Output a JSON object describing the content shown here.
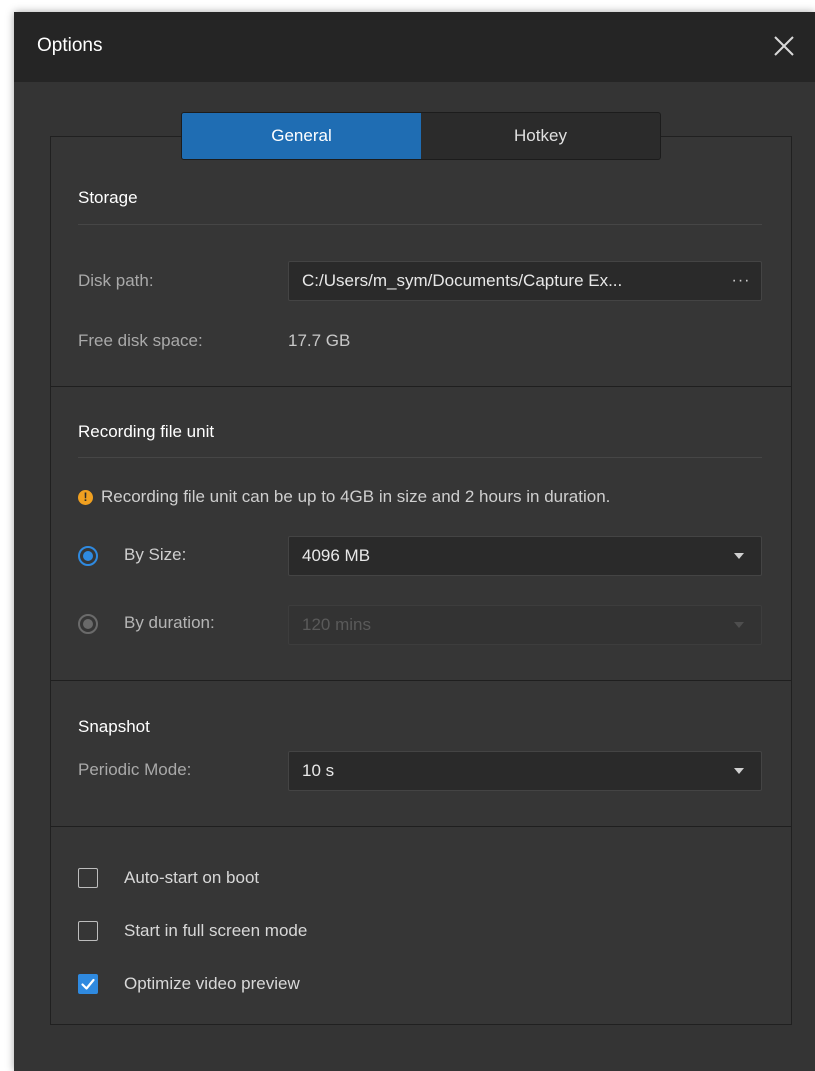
{
  "window": {
    "title": "Options"
  },
  "tabs": [
    {
      "label": "General",
      "active": true
    },
    {
      "label": "Hotkey",
      "active": false
    }
  ],
  "storage": {
    "title": "Storage",
    "disk_path_label": "Disk path:",
    "disk_path_value": "C:/Users/m_sym/Documents/Capture Ex...",
    "browse_label": "···",
    "free_space_label": "Free disk space:",
    "free_space_value": "17.7 GB"
  },
  "recording": {
    "title": "Recording file unit",
    "notice": "Recording file unit can be up to 4GB in size and 2 hours in duration.",
    "notice_icon": "!",
    "by_size_label": "By Size:",
    "by_size_value": "4096 MB",
    "by_size_selected": true,
    "by_duration_label": "By duration:",
    "by_duration_value": "120 mins",
    "by_duration_selected": false
  },
  "snapshot": {
    "title": "Snapshot",
    "periodic_label": "Periodic Mode:",
    "periodic_value": "10 s"
  },
  "options": [
    {
      "label": "Auto-start on boot",
      "checked": false
    },
    {
      "label": "Start in full screen mode",
      "checked": false
    },
    {
      "label": "Optimize video preview",
      "checked": true
    }
  ],
  "colors": {
    "accent": "#1f6db3",
    "check_accent": "#2f8ae0",
    "warning": "#f0a020",
    "background": "#343434",
    "titlebar": "#252525"
  }
}
